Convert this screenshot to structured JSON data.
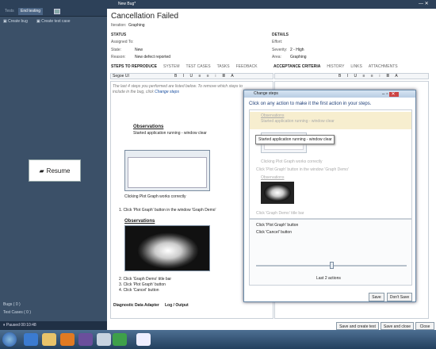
{
  "left_panel": {
    "tabs": [
      "Tests",
      "End testing"
    ],
    "toolbar": {
      "create_bug": "Create bug",
      "create_test_case": "Create test case"
    },
    "resume_label": "Resume",
    "bugs_label": "Bugs ( 0 )",
    "test_cases_label": "Test Cases ( 0 )",
    "status": "Paused 00:10:48"
  },
  "window": {
    "title": "New Bug*"
  },
  "bug": {
    "title": "Cancellation Failed",
    "iteration_label": "Iteration:",
    "iteration_value": "Graphing",
    "status_header": "STATUS",
    "details_header": "DETAILS",
    "assigned_to_label": "Assigned To:",
    "state_label": "State:",
    "state_value": "New",
    "reason_label": "Reason:",
    "reason_value": "New defect reported",
    "effort_label": "Effort:",
    "severity_label": "Severity:",
    "severity_value": "2 - High",
    "area_label": "Area:",
    "area_value": "Graphing"
  },
  "tabs_left": [
    "STEPS TO REPRODUCE",
    "SYSTEM",
    "TEST CASES",
    "TASKS",
    "FEEDBACK"
  ],
  "tabs_right": [
    "ACCEPTANCE CRITERIA",
    "HISTORY",
    "LINKS",
    "ATTACHMENTS"
  ],
  "editor": {
    "font": "Segoe UI",
    "intro": "The last 4 steps you performed are listed below. To remove which steps to include in the bug, click",
    "intro_link": "Change steps",
    "observations": "Observations",
    "obs_text": "Started application running - window clear",
    "caption1": "Clicking Plot Graph works correctly",
    "step1": "1.  Click 'Plot Graph' button in the window 'Graph Demo'",
    "observations2": "Observations",
    "step2": "2.  Click 'Graph Demo' title bar",
    "step3": "3.  Click 'Plot Graph' button",
    "step4": "4.  Click 'Cancel' button",
    "diag": "Diagnostic Data Adapter",
    "log": "Log / Output"
  },
  "dialog": {
    "title": "Change steps",
    "heading": "Click on any action to make it the first action in your steps.",
    "tooltip": "Started application running - window clear",
    "faded_obs": "Observations",
    "faded_obs_text": "Started application running - window clear",
    "faded_caption": "Clicking Plot Graph works correctly",
    "faded_step": "Click 'Plot Graph' button in the window 'Graph Demo'",
    "faded_obs2": "Observations",
    "faded_step2": "Click 'Graph Demo' title bar",
    "step_a": "Click 'Plot Graph' button",
    "step_b": "Click 'Cancel' button",
    "slider_label": "Last 2 actions",
    "slider_value": 0.5,
    "save": "Save",
    "dont_save": "Don't Save"
  },
  "footer_buttons": {
    "save_create": "Save and create test",
    "save_close": "Save and close",
    "close": "Close"
  },
  "colors": {
    "accent": "#2d4159",
    "link": "#1a4fa0"
  }
}
